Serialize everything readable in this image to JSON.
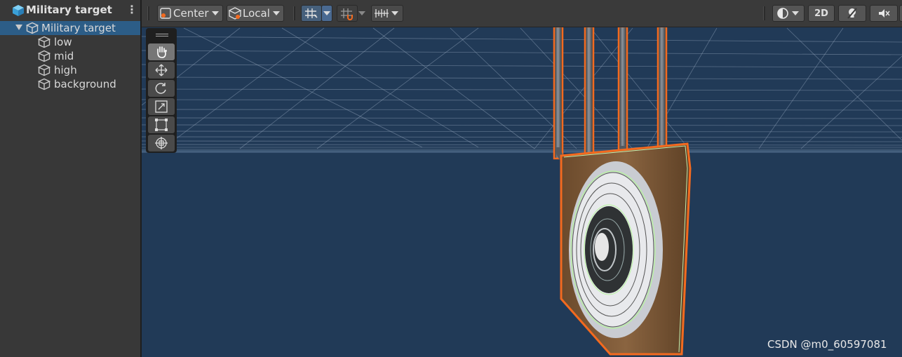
{
  "hierarchy": {
    "title": "Military target",
    "menu_glyph": "⋮",
    "root": {
      "label": "Military target"
    },
    "children": [
      {
        "label": "low"
      },
      {
        "label": "mid"
      },
      {
        "label": "high"
      },
      {
        "label": "background"
      }
    ]
  },
  "toolbar": {
    "pivot_mode": "Center",
    "pivot_rotation": "Local",
    "mode_2d": "2D"
  },
  "tools": [
    "hand-tool",
    "move-tool",
    "rotate-tool",
    "scale-tool",
    "rect-tool",
    "transform-tool"
  ],
  "watermark": "CSDN @m0_60597081",
  "colors": {
    "scene_background": "#213a57",
    "selection_outline": "#f36a1f",
    "hierarchy_selection": "#2c5d87"
  }
}
